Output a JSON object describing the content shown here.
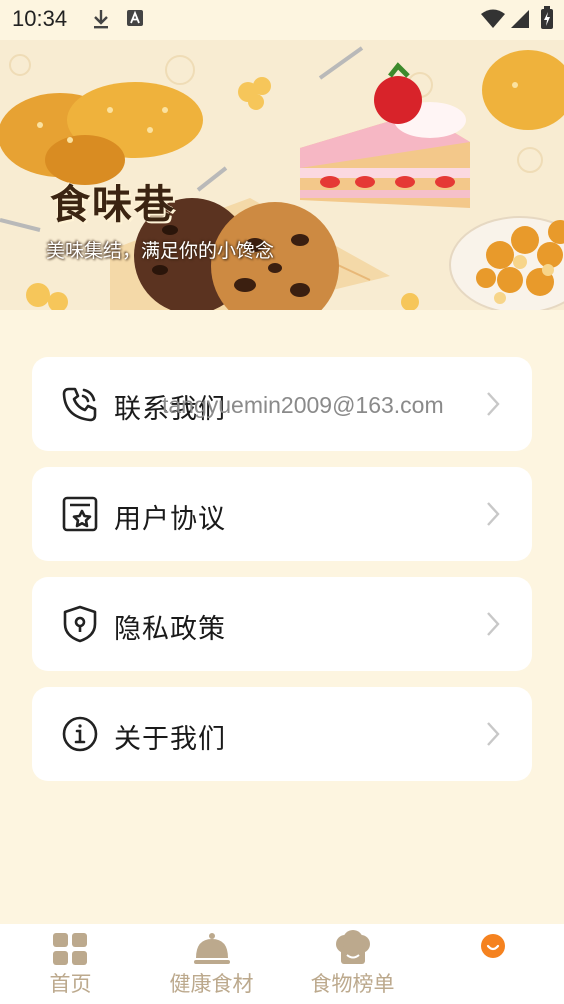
{
  "status_bar": {
    "time": "10:34",
    "icons": [
      "download-icon",
      "a-notification-icon",
      "wifi-icon",
      "signal-icon",
      "battery-icon"
    ]
  },
  "banner": {
    "title": "食味巷",
    "subtitle": "美味集结，满足你的小馋念"
  },
  "menu": {
    "contact": {
      "label": "联系我们",
      "value": "tangyuemin2009@163.com",
      "icon": "phone-icon"
    },
    "agreement": {
      "label": "用户协议",
      "icon": "document-star-icon"
    },
    "privacy": {
      "label": "隐私政策",
      "icon": "shield-icon"
    },
    "about": {
      "label": "关于我们",
      "icon": "info-icon"
    }
  },
  "tabbar": {
    "tabs": [
      {
        "label": "首页",
        "icon": "grid-icon",
        "active": false
      },
      {
        "label": "健康食材",
        "icon": "cloche-icon",
        "active": false
      },
      {
        "label": "食物榜单",
        "icon": "chef-hat-icon",
        "active": false
      },
      {
        "label": "",
        "icon": "smile-icon",
        "active": true
      }
    ]
  },
  "colors": {
    "background": "#fdf5e0",
    "card": "#ffffff",
    "tab_inactive": "#bca98d",
    "tab_active": "#f5821f"
  }
}
